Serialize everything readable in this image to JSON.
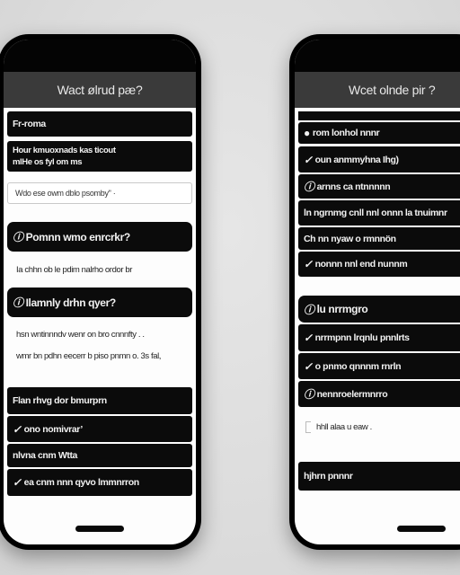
{
  "left_phone": {
    "title": "Wact ølrud pæ?",
    "section_label": "Fr-roma",
    "info_box": [
      "Hour kmuoxnads kas ticout",
      "mlHe os fyl om ms"
    ],
    "input_placeholder": "Wdo ese owm dblo psomby\" ·",
    "question_1": {
      "icon": "info-icon",
      "label": "Pomnn wmo enrcrkr?"
    },
    "answer_1": "Ia chhn ob le pdim nalrho ordor br",
    "question_2": {
      "icon": "info-icon",
      "label": "Ilamnly drhn qyer?"
    },
    "answer_2": [
      "hsn wntinnndv wenr on bro cnnnfty . .",
      "wmr bn pdhn eecerr b piso pnmn o. 3s fal,"
    ],
    "options_header": "Flan rhvg dor bmurprn",
    "options": [
      {
        "icon": "check-icon",
        "label": "ono nomivrar’"
      },
      {
        "icon": "",
        "label": "nlvna cnm Wtta"
      },
      {
        "icon": "check-icon",
        "label": "ea cnm nnn qyvo lmmnrron"
      }
    ]
  },
  "right_phone": {
    "title": "Wcet olnde pir ?",
    "rows": [
      {
        "icon": "info-icon",
        "label": "rom lonhol nnnr"
      },
      {
        "icon": "check-icon",
        "label": "oun anmmyhna Ihg)"
      },
      {
        "icon": "info-icon",
        "label": "arnns ca ntnnnnn"
      },
      {
        "icon": "",
        "label": "ln ngrnmg cnll nnl onnn la tnuimnr"
      },
      {
        "icon": "",
        "label": "Ch nn nyaw o rmnnön"
      },
      {
        "icon": "check-icon",
        "label": "nonnn nnl end nunnm"
      }
    ],
    "group_header": {
      "icon": "info-icon",
      "label": "lu nrrmgro"
    },
    "group_options": [
      {
        "icon": "check-icon",
        "label": "nrrmpnn lrqnlu pnnlrts"
      },
      {
        "icon": "check-icon",
        "label": "o pnmo qnnnm rnrln"
      },
      {
        "icon": "info-icon",
        "label": "nennroelermnrro"
      }
    ],
    "checkbox_label": "hhll alaa u eaw .",
    "footer_button": "hjhrn pnnnr"
  }
}
